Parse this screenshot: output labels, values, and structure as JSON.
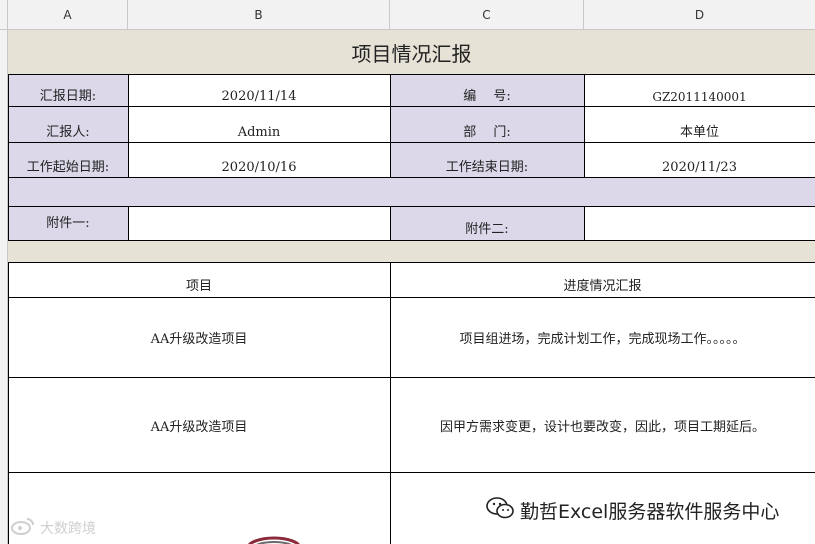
{
  "columns": [
    "A",
    "B",
    "C",
    "D"
  ],
  "title": "项目情况汇报",
  "fields": {
    "report_date_label": "汇报日期:",
    "report_date_value": "2020/11/14",
    "number_label": "编　 号:",
    "number_value": "GZ2011140001",
    "reporter_label": "汇报人:",
    "reporter_value": "Admin",
    "department_label": "部　 门:",
    "department_value": "本单位",
    "start_date_label": "工作起始日期:",
    "start_date_value": "2020/10/16",
    "end_date_label": "工作结束日期:",
    "end_date_value": "2020/11/23",
    "attachment1_label": "附件一:",
    "attachment2_label": "附件二:"
  },
  "table": {
    "headers": [
      "项目",
      "进度情况汇报"
    ],
    "rows": [
      {
        "project": "AA升级改造项目",
        "progress": "项目组进场，完成计划工作，完成现场工作。。。。。"
      },
      {
        "project": "AA升级改造项目",
        "progress": "因甲方需求变更，设计也要改变，因此，项目工期延后。"
      }
    ]
  },
  "watermark": {
    "right_text": "勤哲Excel服务器软件服务中心",
    "right_icon": "wechat-icon",
    "left_text": "大数跨境",
    "left_icon": "weibo-icon"
  }
}
